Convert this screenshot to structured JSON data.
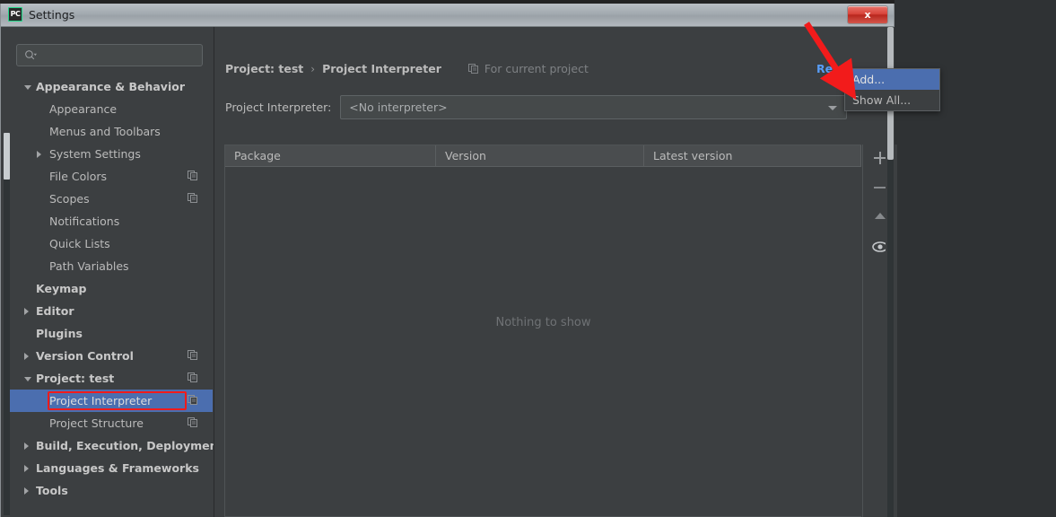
{
  "window": {
    "title": "Settings",
    "app_icon": "pycharm-icon",
    "close_label": "x"
  },
  "search": {
    "placeholder": "",
    "value": "",
    "icon": "search-icon"
  },
  "sidebar": {
    "items": [
      {
        "label": "Appearance & Behavior",
        "indent": 0,
        "bold": true,
        "arrow": "down",
        "copy": false,
        "selected": false
      },
      {
        "label": "Appearance",
        "indent": 1,
        "bold": false,
        "arrow": "none",
        "copy": false,
        "selected": false
      },
      {
        "label": "Menus and Toolbars",
        "indent": 1,
        "bold": false,
        "arrow": "none",
        "copy": false,
        "selected": false
      },
      {
        "label": "System Settings",
        "indent": 1,
        "bold": false,
        "arrow": "right",
        "copy": false,
        "selected": false
      },
      {
        "label": "File Colors",
        "indent": 1,
        "bold": false,
        "arrow": "none",
        "copy": true,
        "selected": false
      },
      {
        "label": "Scopes",
        "indent": 1,
        "bold": false,
        "arrow": "none",
        "copy": true,
        "selected": false
      },
      {
        "label": "Notifications",
        "indent": 1,
        "bold": false,
        "arrow": "none",
        "copy": false,
        "selected": false
      },
      {
        "label": "Quick Lists",
        "indent": 1,
        "bold": false,
        "arrow": "none",
        "copy": false,
        "selected": false
      },
      {
        "label": "Path Variables",
        "indent": 1,
        "bold": false,
        "arrow": "none",
        "copy": false,
        "selected": false
      },
      {
        "label": "Keymap",
        "indent": 0,
        "bold": true,
        "arrow": "none",
        "copy": false,
        "selected": false
      },
      {
        "label": "Editor",
        "indent": 0,
        "bold": true,
        "arrow": "right",
        "copy": false,
        "selected": false
      },
      {
        "label": "Plugins",
        "indent": 0,
        "bold": true,
        "arrow": "none",
        "copy": false,
        "selected": false
      },
      {
        "label": "Version Control",
        "indent": 0,
        "bold": true,
        "arrow": "right",
        "copy": true,
        "selected": false
      },
      {
        "label": "Project: test",
        "indent": 0,
        "bold": true,
        "arrow": "down",
        "copy": true,
        "selected": false
      },
      {
        "label": "Project Interpreter",
        "indent": 1,
        "bold": false,
        "arrow": "none",
        "copy": true,
        "selected": true
      },
      {
        "label": "Project Structure",
        "indent": 1,
        "bold": false,
        "arrow": "none",
        "copy": true,
        "selected": false
      },
      {
        "label": "Build, Execution, Deployment",
        "indent": 0,
        "bold": true,
        "arrow": "right",
        "copy": false,
        "selected": false
      },
      {
        "label": "Languages & Frameworks",
        "indent": 0,
        "bold": true,
        "arrow": "right",
        "copy": false,
        "selected": false
      },
      {
        "label": "Tools",
        "indent": 0,
        "bold": true,
        "arrow": "right",
        "copy": false,
        "selected": false
      }
    ]
  },
  "pane": {
    "breadcrumb": {
      "project": "Project: test",
      "separator": "›",
      "page": "Project Interpreter",
      "note": "For current project",
      "note_icon": "copy-icon"
    },
    "reset_label": "Reset",
    "interpreter": {
      "label": "Project Interpreter:",
      "value": "<No interpreter>",
      "arrow_icon": "chevron-down-icon"
    },
    "table": {
      "columns": [
        "Package",
        "Version",
        "Latest version"
      ],
      "rows": [],
      "empty_message": "Nothing to show"
    },
    "toolbar": [
      {
        "name": "add-package-button",
        "icon": "plus-icon"
      },
      {
        "name": "remove-package-button",
        "icon": "minus-icon"
      },
      {
        "name": "upgrade-package-button",
        "icon": "arrow-up-icon"
      },
      {
        "name": "show-early-releases-button",
        "icon": "eye-icon"
      }
    ]
  },
  "popup_menu": {
    "items": [
      {
        "label": "Add...",
        "active": true
      },
      {
        "label": "Show All...",
        "active": false
      }
    ]
  },
  "annotation": {
    "arrow_color": "#f21b1b",
    "highlight_color": "#f21b1b",
    "accent_color": "#4b6eaf",
    "link_color": "#589df6"
  }
}
